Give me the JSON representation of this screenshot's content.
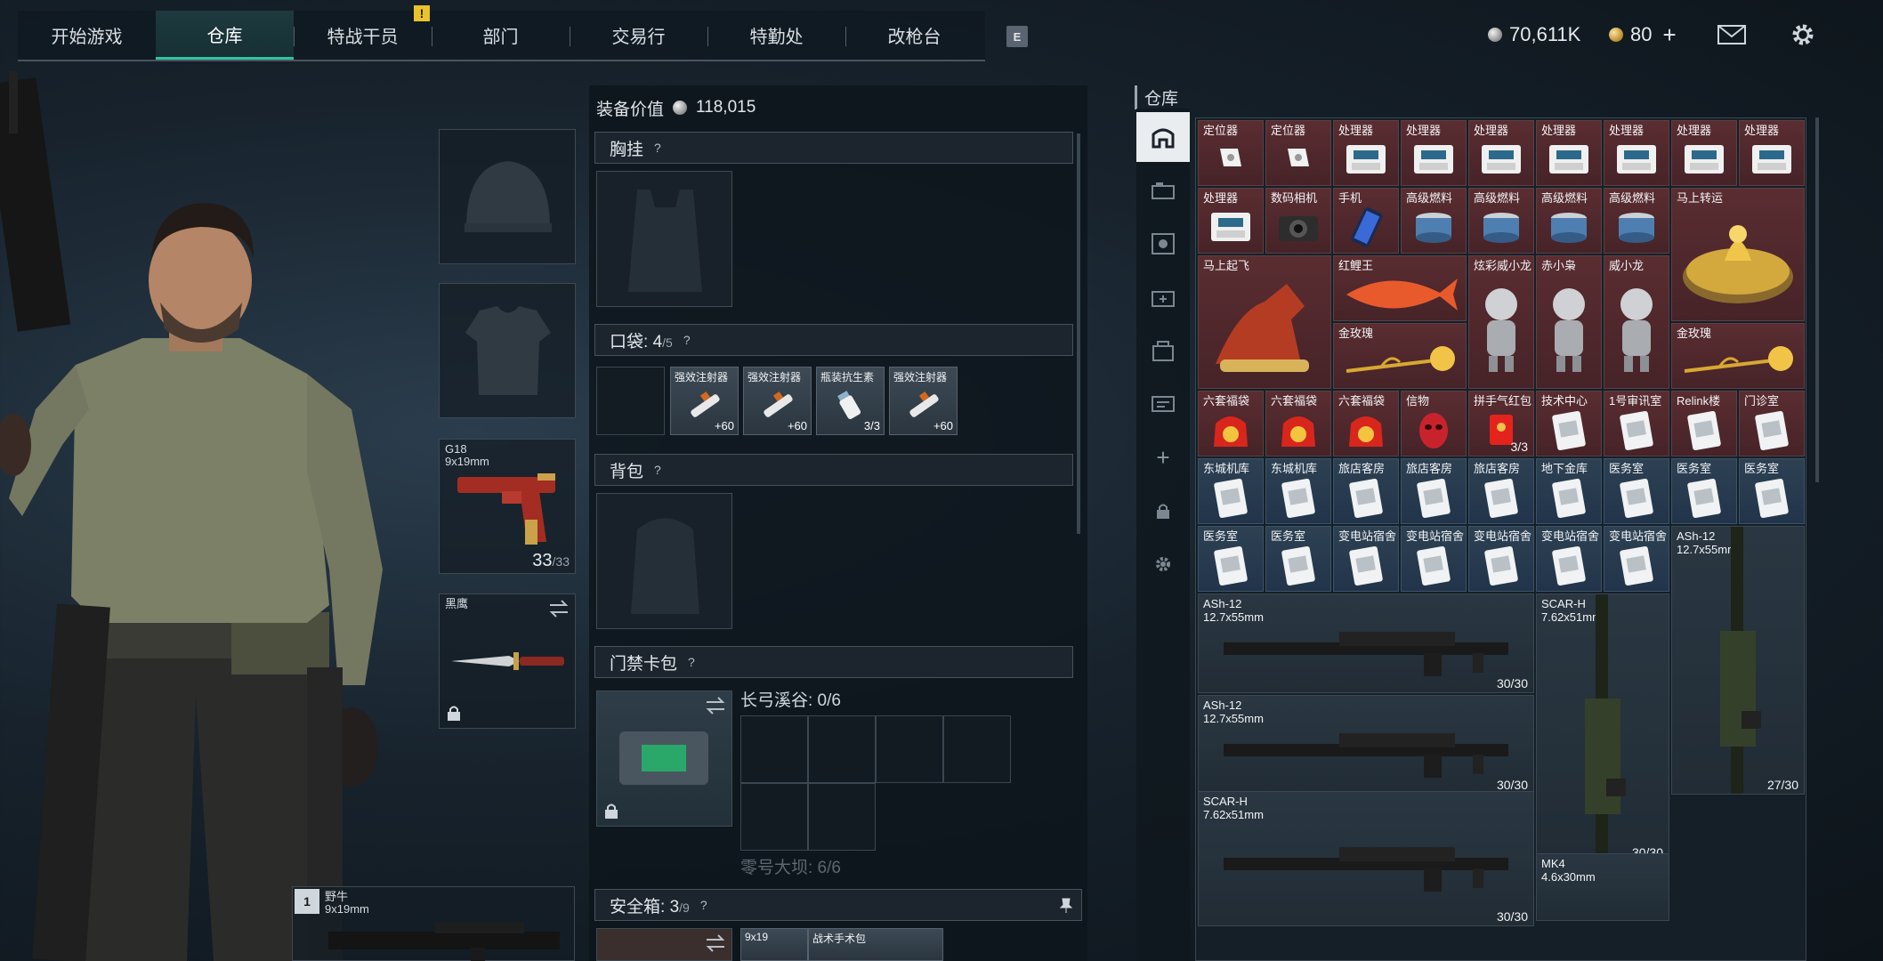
{
  "nav": {
    "tabs": [
      {
        "label": "开始游戏"
      },
      {
        "label": "仓库",
        "active": true
      },
      {
        "label": "特战干员",
        "badge": "!"
      },
      {
        "label": "部门"
      },
      {
        "label": "交易行"
      },
      {
        "label": "特勤处"
      },
      {
        "label": "改枪台"
      }
    ],
    "hotkey": "E"
  },
  "header": {
    "silver_balance": "70,611K",
    "gold_balance": "80",
    "gold_add": "+",
    "icons": [
      "mail-icon",
      "gear-icon"
    ]
  },
  "colors": {
    "accent": "#31c2a3",
    "badge": "#e9c22c",
    "rare_red": "#5a2d31",
    "rare_blue": "#2d4153"
  },
  "loadout": {
    "pistol": {
      "name": "G18",
      "caliber": "9x19mm",
      "ammo": "33",
      "ammo_max": "/33"
    },
    "melee": {
      "name": "黑鹰"
    },
    "primary": {
      "name": "野牛",
      "caliber": "9x19mm"
    }
  },
  "equipment": {
    "value_label": "装备价值",
    "value": "118,015",
    "chest_rig": {
      "label": "胸挂",
      "help": "?"
    },
    "pockets": {
      "label": "口袋:",
      "used": "4",
      "max": "/5",
      "help": "?",
      "items": [
        {
          "name": "强效注射器",
          "qty": "+60"
        },
        {
          "name": "强效注射器",
          "qty": "+60"
        },
        {
          "name": "瓶装抗生素",
          "qty": "3/3"
        },
        {
          "name": "强效注射器",
          "qty": "+60"
        }
      ]
    },
    "backpack": {
      "label": "背包",
      "help": "?"
    },
    "keycard": {
      "label": "门禁卡包",
      "help": "?",
      "row1": "长弓溪谷: 0/6",
      "row2": "零号大坝: 6/6"
    },
    "safebox": {
      "label": "安全箱:",
      "used": "3",
      "max": "/9",
      "help": "?",
      "items": [
        {
          "name": "9x19"
        },
        {
          "name": "战术手术包"
        }
      ]
    }
  },
  "warehouse": {
    "title": "仓库",
    "sidebar": [
      "home-icon",
      "category-icon-1",
      "category-icon-2",
      "category-icon-3",
      "category-icon-4",
      "category-icon-5",
      "add-icon",
      "lock-icon",
      "settings-icon"
    ],
    "small_items": [
      {
        "label": "定位器",
        "icon": "locator",
        "tone": "red"
      },
      {
        "label": "定位器",
        "icon": "locator",
        "tone": "red"
      },
      {
        "label": "处理器",
        "icon": "processor",
        "tone": "red"
      },
      {
        "label": "处理器",
        "icon": "processor",
        "tone": "red"
      },
      {
        "label": "处理器",
        "icon": "processor",
        "tone": "red"
      },
      {
        "label": "处理器",
        "icon": "processor",
        "tone": "red"
      },
      {
        "label": "处理器",
        "icon": "processor",
        "tone": "red"
      },
      {
        "label": "处理器",
        "icon": "processor",
        "tone": "red"
      },
      {
        "label": "处理器",
        "icon": "processor",
        "tone": "red"
      },
      {
        "label": "处理器",
        "icon": "processor",
        "tone": "red"
      },
      {
        "label": "数码相机",
        "icon": "camera",
        "tone": "red"
      },
      {
        "label": "手机",
        "icon": "phone",
        "tone": "red"
      },
      {
        "label": "高级燃料",
        "icon": "fuel",
        "tone": "red"
      },
      {
        "label": "高级燃料",
        "icon": "fuel",
        "tone": "red"
      },
      {
        "label": "高级燃料",
        "icon": "fuel",
        "tone": "red"
      },
      {
        "label": "高级燃料",
        "icon": "fuel",
        "tone": "red"
      }
    ],
    "large_items": [
      {
        "label": "马上转运",
        "icon": "wheel"
      },
      {
        "label": "马上起飞",
        "icon": "horse"
      },
      {
        "label": "红鲤王",
        "icon": "fish"
      },
      {
        "label": "金玫瑰",
        "icon": "rose"
      },
      {
        "label": "炫彩威小龙",
        "icon": "figure"
      },
      {
        "label": "赤小枭",
        "icon": "figure"
      },
      {
        "label": "威小龙",
        "icon": "figure"
      },
      {
        "label": "金玫瑰",
        "icon": "rose"
      }
    ],
    "row5": [
      {
        "label": "六套福袋",
        "icon": "bag",
        "tone": "red"
      },
      {
        "label": "六套福袋",
        "icon": "bag",
        "tone": "red"
      },
      {
        "label": "六套福袋",
        "icon": "bag",
        "tone": "red"
      },
      {
        "label": "信物",
        "icon": "mask",
        "tone": "red"
      },
      {
        "label": "拼手气红包",
        "icon": "envelope",
        "tone": "red",
        "qty": "3/3"
      },
      {
        "label": "技术中心",
        "icon": "card",
        "tone": "red"
      },
      {
        "label": "1号审讯室",
        "icon": "card",
        "tone": "red"
      },
      {
        "label": "Relink楼",
        "icon": "card",
        "tone": "red"
      },
      {
        "label": "门诊室",
        "icon": "card",
        "tone": "red"
      }
    ],
    "row6": [
      {
        "label": "东城机库",
        "icon": "card"
      },
      {
        "label": "东城机库",
        "icon": "card"
      },
      {
        "label": "旅店客房",
        "icon": "card"
      },
      {
        "label": "旅店客房",
        "icon": "card"
      },
      {
        "label": "旅店客房",
        "icon": "card"
      },
      {
        "label": "地下金库",
        "icon": "card"
      },
      {
        "label": "医务室",
        "icon": "card"
      },
      {
        "label": "医务室",
        "icon": "card"
      },
      {
        "label": "医务室",
        "icon": "card"
      }
    ],
    "row7": [
      {
        "label": "医务室",
        "icon": "card"
      },
      {
        "label": "医务室",
        "icon": "card"
      },
      {
        "label": "变电站宿舍",
        "icon": "card"
      },
      {
        "label": "变电站宿舍",
        "icon": "card"
      },
      {
        "label": "变电站宿舍",
        "icon": "card"
      },
      {
        "label": "变电站宿舍",
        "icon": "card"
      },
      {
        "label": "变电站宿舍",
        "icon": "card"
      }
    ],
    "weapons": [
      {
        "name": "ASh-12",
        "caliber": "12.7x55mm",
        "ammo": "30/30"
      },
      {
        "name": "ASh-12",
        "caliber": "12.7x55mm",
        "ammo": "30/30"
      },
      {
        "name": "SCAR-H",
        "caliber": "7.62x51mm",
        "ammo": "30/30"
      },
      {
        "name": "ASh-12",
        "caliber": "12.7x55mm",
        "ammo": "27/30"
      },
      {
        "name": "SCAR-H",
        "caliber": "7.62x51mm",
        "ammo": "30/30"
      },
      {
        "name": "MK4",
        "caliber": "4.6x30mm"
      }
    ]
  }
}
